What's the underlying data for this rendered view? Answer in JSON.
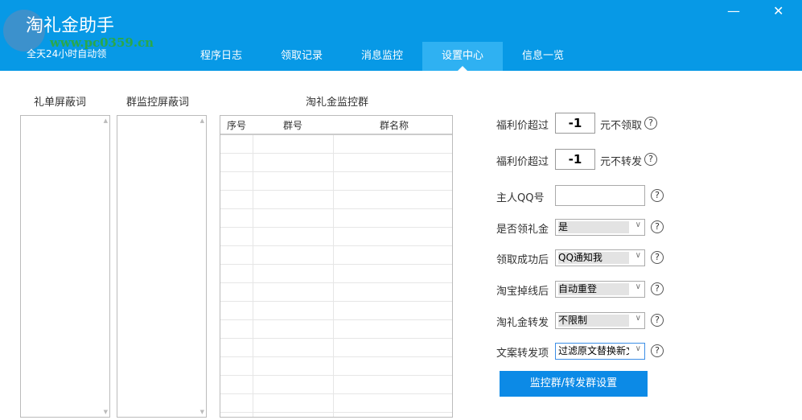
{
  "header": {
    "title": "淘礼金助手",
    "subtitle": "全天24小时自动领",
    "watermark": "www.pc0359.cn",
    "minimize": "—",
    "close": "✕"
  },
  "tabs": [
    {
      "label": "程序日志"
    },
    {
      "label": "领取记录"
    },
    {
      "label": "消息监控"
    },
    {
      "label": "设置中心",
      "active": true
    },
    {
      "label": "信息一览"
    }
  ],
  "lists": {
    "gift_block": "礼单屏蔽词",
    "group_block": "群监控屏蔽词",
    "monitor_groups": "淘礼金监控群"
  },
  "table": {
    "columns": [
      "序号",
      "群号",
      "群名称"
    ]
  },
  "settings": {
    "welfare1": {
      "label": "福利价超过",
      "value": "-1",
      "suffix": "元不领取"
    },
    "welfare2": {
      "label": "福利价超过",
      "value": "-1",
      "suffix": "元不转发"
    },
    "owner_qq": {
      "label": "主人QQ号",
      "value": ""
    },
    "selects": [
      {
        "label": "是否领礼金",
        "value": "是"
      },
      {
        "label": "领取成功后",
        "value": "QQ通知我"
      },
      {
        "label": "淘宝掉线后",
        "value": "自动重登"
      },
      {
        "label": "淘礼金转发",
        "value": "不限制"
      },
      {
        "label": "文案转发项",
        "value": "过滤原文替换新文"
      }
    ],
    "help": "?",
    "button": "监控群/转发群设置"
  }
}
